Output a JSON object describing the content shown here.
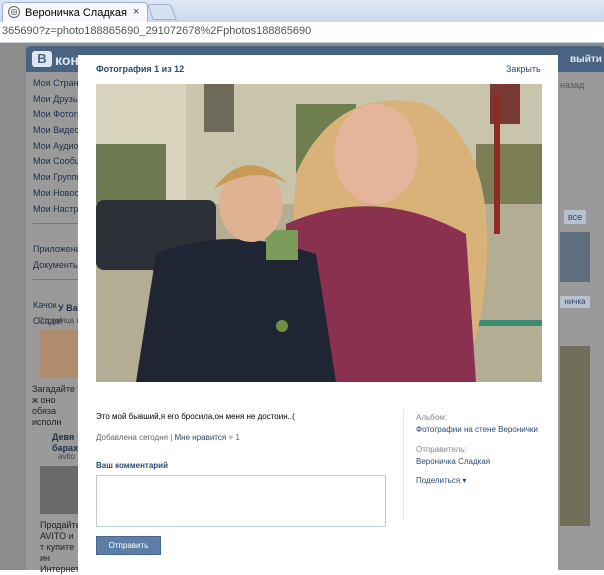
{
  "browser": {
    "tab_title": "Вероничка Сладкая",
    "tab_close": "×",
    "address": "365690?z=photo188865690_291072678%2Fphotos188865690"
  },
  "background": {
    "logo_letter": "В",
    "logo_text": "конт",
    "exit": "выйти",
    "menu": [
      "Моя Страница",
      "Мои Друзья",
      "Мои Фотографии",
      "Мои Видеозаписи",
      "Мои Аудиозаписи",
      "Мои Сообщения",
      "Мои Группы",
      "Мои Новости",
      "Мои Настройки"
    ],
    "menu2": [
      "Приложения",
      "Документы"
    ],
    "menu3": [
      "Качок",
      "Осада!"
    ],
    "ad1_title": "У Вас Н",
    "ad1_sub": "Страница н",
    "ad1_text": "Загадайте ж оно обяза исполн",
    "ad2_title": "Девя барах",
    "ad2_sub": "avito",
    "ad2_text": "Продайте AVITO и т купите ин Интернет",
    "right_back": "назад",
    "right_all": "все",
    "right_more": "ничка"
  },
  "photo_view": {
    "counter": "Фотография 1 из 12",
    "close": "Закрыть",
    "caption": "Это мой бывший,я его бросила,он меня не достоин..(",
    "added": "Добавлена сегодня",
    "separator": "|",
    "like_label": "Мне нравится",
    "like_heart": "♥",
    "like_count": "1",
    "album_label": "Альбом:",
    "album_name": "Фотографии на стене Веронички",
    "sender_label": "Отправитель:",
    "sender_name": "Вероничка Сладкая",
    "share": "Поделиться ▾",
    "comment_title": "Ваш комментарий",
    "comment_value": "",
    "send": "Отправить"
  }
}
